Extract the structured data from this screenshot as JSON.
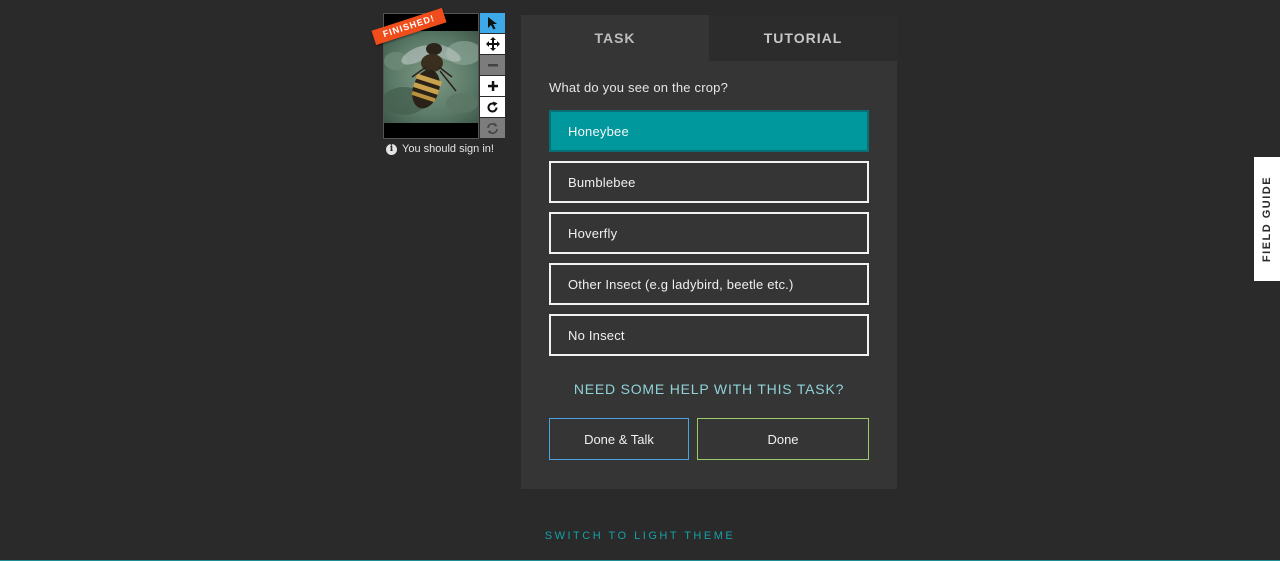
{
  "viewer": {
    "badge": "FINISHED!",
    "tools": [
      {
        "name": "pointer",
        "icon": "cursor-arrow-icon",
        "state": "active"
      },
      {
        "name": "pan",
        "icon": "move-arrows-icon",
        "state": "enabled"
      },
      {
        "name": "zoom-out",
        "icon": "minus-icon",
        "state": "disabled"
      },
      {
        "name": "zoom-in",
        "icon": "plus-icon",
        "state": "enabled"
      },
      {
        "name": "rotate",
        "icon": "rotate-icon",
        "state": "enabled"
      },
      {
        "name": "reset",
        "icon": "refresh-icon",
        "state": "disabled"
      }
    ],
    "signin_text": "You should sign in!"
  },
  "panel": {
    "tabs": [
      {
        "label": "TASK",
        "active": true
      },
      {
        "label": "TUTORIAL",
        "active": false
      }
    ],
    "question": "What do you see on the crop?",
    "answers": [
      {
        "label": "Honeybee",
        "selected": true
      },
      {
        "label": "Bumblebee",
        "selected": false
      },
      {
        "label": "Hoverfly",
        "selected": false
      },
      {
        "label": "Other Insect (e.g ladybird, beetle etc.)",
        "selected": false
      },
      {
        "label": "No Insect",
        "selected": false
      }
    ],
    "help_link": "NEED SOME HELP WITH THIS TASK?",
    "done_talk_label": "Done & Talk",
    "done_label": "Done"
  },
  "field_guide_label": "FIELD GUIDE",
  "theme_switch_label": "SWITCH TO LIGHT THEME",
  "colors": {
    "background": "#2a2a2a",
    "panel": "#353535",
    "selected_answer": "#00979d",
    "badge": "#ef4d1b",
    "active_tool": "#3da9e8",
    "accent_teal": "#17a0a8"
  }
}
